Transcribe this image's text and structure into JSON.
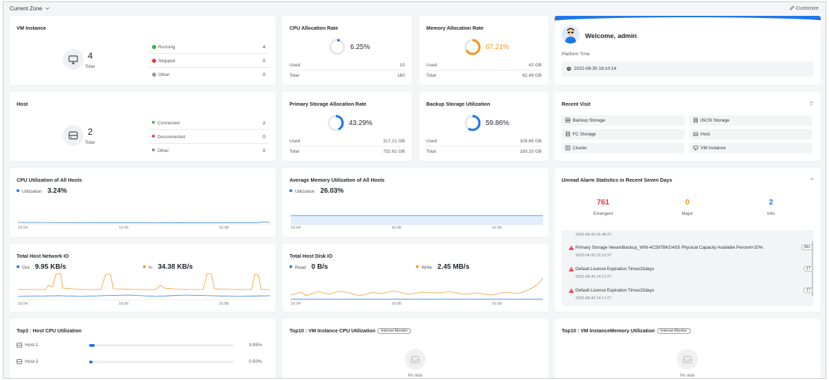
{
  "topbar": {
    "zone_label": "Current Zone",
    "customize_label": "Customize"
  },
  "colors": {
    "accent": "#1e77e8",
    "orange": "#f7941d",
    "red": "#e8363d",
    "green": "#36b24a",
    "gray": "#888888"
  },
  "vm": {
    "title": "VM Instance",
    "total": "4",
    "total_label": "Total",
    "rows": [
      {
        "label": "Running",
        "value": "4"
      },
      {
        "label": "Stopped",
        "value": "0"
      },
      {
        "label": "Other",
        "value": "0"
      }
    ]
  },
  "host": {
    "title": "Host",
    "total": "2",
    "total_label": "Total",
    "rows": [
      {
        "label": "Connected",
        "value": "2"
      },
      {
        "label": "Disconnected",
        "value": "0"
      },
      {
        "label": "Other",
        "value": "0"
      }
    ]
  },
  "cpu_alloc": {
    "title": "CPU Allocation Rate",
    "pct": "6.25%",
    "fraction": 0.0625,
    "used_label": "Used",
    "used": "10",
    "total_label": "Total",
    "total": "160"
  },
  "mem_alloc": {
    "title": "Memory Allocation Rate",
    "pct": "67.21%",
    "fraction": 0.6721,
    "used_label": "Used",
    "used": "42 GB",
    "total_label": "Total",
    "total": "62.49 GB"
  },
  "primary": {
    "title": "Primary Storage Allocation Rate",
    "pct": "43.29%",
    "fraction": 0.4329,
    "used_label": "Used",
    "used": "317.21 GB",
    "total_label": "Total",
    "total": "732.61 GB"
  },
  "backup": {
    "title": "Backup Storage Utilization",
    "pct": "59.86%",
    "fraction": 0.5986,
    "used_label": "Used",
    "used": "109.65 GB",
    "total_label": "Total",
    "total": "183.15 GB"
  },
  "welcome": {
    "greeting": "Welcome, admin",
    "platform_label": "Platform Time",
    "time": "2022-08-30 16:10:14"
  },
  "recent": {
    "title": "Recent Visit",
    "items": [
      {
        "label": "Backup Storage",
        "icon": "backup-storage-icon"
      },
      {
        "label": "iSCSI Storage",
        "icon": "iscsi-storage-icon"
      },
      {
        "label": "FC Storage",
        "icon": "fc-storage-icon"
      },
      {
        "label": "Host",
        "icon": "host-icon"
      },
      {
        "label": "Cluster",
        "icon": "cluster-icon"
      },
      {
        "label": "VM Instance",
        "icon": "vm-instance-icon"
      }
    ]
  },
  "cpu_util": {
    "title": "CPU Utilization of All Hosts",
    "legend": "Utilization",
    "value": "3.24%",
    "ticks": [
      "16:04",
      "16:06",
      "16:08"
    ]
  },
  "mem_util": {
    "title": "Average Memory Utilization of All Hosts",
    "legend": "Utilization",
    "value": "26.03%",
    "ticks": [
      "16:04",
      "16:06",
      "16:08"
    ]
  },
  "net_io": {
    "title": "Total Host Network IO",
    "out_label": "Out",
    "out_value": "9.95 KB/s",
    "in_label": "In",
    "in_value": "34.38 KB/s",
    "ticks": [
      "16:04",
      "16:06",
      "16:08"
    ]
  },
  "disk_io": {
    "title": "Total Host Disk IO",
    "read_label": "Read",
    "read_value": "0 B/s",
    "write_label": "Write",
    "write_value": "2.45 MB/s",
    "ticks": [
      "16:04",
      "16:06",
      "16:08"
    ]
  },
  "alarms": {
    "title": "Unread Alarm Statistics in Recent Seven Days",
    "stats": [
      {
        "value": "761",
        "label": "Emergent",
        "color": "#e8363d"
      },
      {
        "value": "0",
        "label": "Major",
        "color": "#f7941d"
      },
      {
        "value": "2",
        "label": "Info",
        "color": "#1e77e8"
      }
    ],
    "first_time": "2022-08-30 15:48:27",
    "items": [
      {
        "text": "Primary Storage VeeamBackup_WIN-4C597BKG4SS Physical Capacity Available Percent<20%",
        "count": "99+",
        "time": "2022-08-30 15:12:37"
      },
      {
        "text": "Default License Expiration Time≤15days",
        "count": "17",
        "time": "2022-08-30 14:17:27"
      },
      {
        "text": "Default License Expiration Time≤15days",
        "count": "17",
        "time": "2022-08-30 14:17:27"
      }
    ]
  },
  "top3": {
    "title": "Top3 : Host CPU Utilization",
    "rows": [
      {
        "label": "Host-1",
        "value": "3.95%",
        "fraction": 0.0395
      },
      {
        "label": "Host-2",
        "value": "0.50%",
        "fraction": 0.005
      }
    ]
  },
  "top10cpu": {
    "title": "Top10 : VM Instance CPU Utilization",
    "tag": "Internal Monitor",
    "nodata": "No data"
  },
  "top10mem": {
    "title": "Top10 : VM InstanceMemory Utilization",
    "tag": "Internal Monitor",
    "nodata": "No data"
  }
}
